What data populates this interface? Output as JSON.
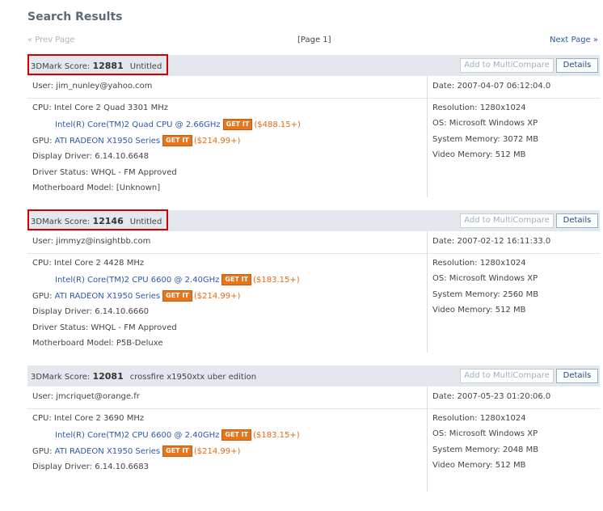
{
  "title": "Search Results",
  "pager": {
    "prev": "« Prev Page",
    "current": "[Page 1]",
    "next": "Next Page »"
  },
  "labels": {
    "score_prefix": "3DMark Score:",
    "add_compare": "Add to MultiCompare",
    "details": "Details",
    "user": "User:",
    "date": "Date:",
    "cpu": "CPU:",
    "gpu": "GPU:",
    "driver": "Display Driver:",
    "status": "Driver Status:",
    "board": "Motherboard Model:",
    "resolution": "Resolution:",
    "os": "OS:",
    "sysmem": "System Memory:",
    "vidmem": "Video Memory:",
    "get_it": "GET IT"
  },
  "results": [
    {
      "score": "12881",
      "name": "Untitled",
      "user": "jim_nunley@yahoo.com",
      "date": "2007-04-07 06:12:04.0",
      "cpu": "Intel Core 2 Quad 3301 MHz",
      "cpu_link": "Intel(R) Core(TM)2 Quad CPU @ 2.66GHz",
      "cpu_price": "($488.15+)",
      "gpu": "ATI RADEON X1950 Series",
      "gpu_price": "($214.99+)",
      "driver": "6.14.10.6648",
      "status": "WHQL - FM Approved",
      "board": "[Unknown]",
      "resolution": "1280x1024",
      "os": "Microsoft Windows XP",
      "sysmem": "3072 MB",
      "vidmem": "512 MB",
      "highlighted": true
    },
    {
      "score": "12146",
      "name": "Untitled",
      "user": "jimmyz@insightbb.com",
      "date": "2007-02-12 16:11:33.0",
      "cpu": "Intel Core 2 4428 MHz",
      "cpu_link": "Intel(R) Core(TM)2 CPU 6600 @ 2.40GHz",
      "cpu_price": "($183.15+)",
      "gpu": "ATI RADEON X1950 Series",
      "gpu_price": "($214.99+)",
      "driver": "6.14.10.6660",
      "status": "WHQL - FM Approved",
      "board": "P5B-Deluxe",
      "resolution": "1280x1024",
      "os": "Microsoft Windows XP",
      "sysmem": "2560 MB",
      "vidmem": "512 MB",
      "highlighted": true
    },
    {
      "score": "12081",
      "name": "crossfire x1950xtx uber edition",
      "user": "jmcriquet@orange.fr",
      "date": "2007-05-23 01:20:06.0",
      "cpu": "Intel Core 2 3690 MHz",
      "cpu_link": "Intel(R) Core(TM)2 CPU 6600 @ 2.40GHz",
      "cpu_price": "($183.15+)",
      "gpu": "ATI RADEON X1950 Series",
      "gpu_price": "($214.99+)",
      "driver": "6.14.10.6683",
      "status": "",
      "board": "",
      "resolution": "1280x1024",
      "os": "Microsoft Windows XP",
      "sysmem": "2048 MB",
      "vidmem": "512 MB",
      "highlighted": false
    }
  ]
}
